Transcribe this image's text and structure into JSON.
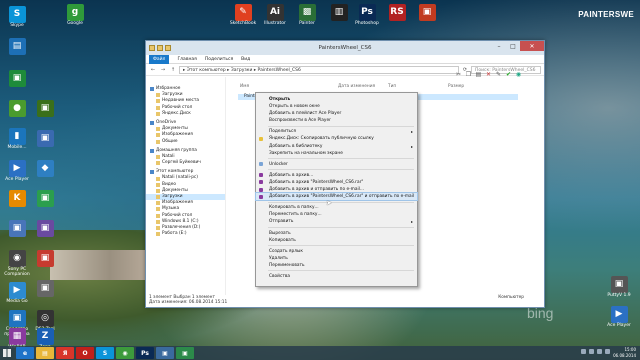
{
  "watermark": "PAINTERSWE",
  "bing": "bing",
  "desktop_icons_left": [
    {
      "label": "Skype",
      "icon": "skype-icon",
      "color": "#0a94d8",
      "glyph": "S"
    },
    {
      "label": "",
      "icon": "folder-icon",
      "color": "#1d6fb5",
      "glyph": "▤"
    },
    {
      "label": "",
      "icon": "app-icon",
      "color": "#1e8b3a",
      "glyph": "▣"
    },
    {
      "label": "",
      "icon": "green-app-icon",
      "color": "#4a9b2e",
      "glyph": "●"
    },
    {
      "label": "",
      "icon": "app-icon",
      "color": "#3a6f1a",
      "glyph": "▣"
    },
    {
      "label": "Mobile...",
      "icon": "mobile-icon",
      "color": "#1b75bc",
      "glyph": "▮"
    },
    {
      "label": "",
      "icon": "app-icon",
      "color": "#3a6ab0",
      "glyph": "▣"
    },
    {
      "label": "Ace Player",
      "icon": "ace-player-icon",
      "color": "#2b70c4",
      "glyph": "▶"
    },
    {
      "label": "",
      "icon": "app-icon",
      "color": "#2e7fc2",
      "glyph": "◆"
    },
    {
      "label": "",
      "icon": "k-icon",
      "color": "#e68a00",
      "glyph": "K"
    },
    {
      "label": "",
      "icon": "app-icon",
      "color": "#2b9e4d",
      "glyph": "▣"
    },
    {
      "label": "",
      "icon": "app-icon",
      "color": "#4875b9",
      "glyph": "▣"
    },
    {
      "label": "",
      "icon": "app-icon",
      "color": "#6a4aa0",
      "glyph": "▣"
    },
    {
      "label": "Sony PC Companion",
      "icon": "sony-icon",
      "color": "#444444",
      "glyph": "◉"
    },
    {
      "label": "",
      "icon": "app-icon",
      "color": "#c63b2f",
      "glyph": "▣"
    },
    {
      "label": "Media Go",
      "icon": "media-go-icon",
      "color": "#2d8bd0",
      "glyph": "▶"
    },
    {
      "label": "",
      "icon": "app-icon",
      "color": "#666666",
      "glyph": "▣"
    },
    {
      "label": "Средство просмотра",
      "icon": "viewer-icon",
      "color": "#1f74c0",
      "glyph": "▣"
    },
    {
      "label": "DS3 Tool",
      "icon": "ds3-icon",
      "color": "#333333",
      "glyph": "◎"
    },
    {
      "label": "WinRAR",
      "icon": "winrar-icon",
      "color": "#8a3a9e",
      "glyph": "▦"
    },
    {
      "label": "Zona",
      "icon": "zona-icon",
      "color": "#1a5fb4",
      "glyph": "Z"
    }
  ],
  "desktop_icons_top": [
    {
      "label": "Google",
      "icon": "google-icon",
      "color": "#2f9a3a",
      "glyph": "g"
    },
    {
      "label": "SketchBook",
      "icon": "sketchbook-icon",
      "color": "#e04020",
      "glyph": "✎"
    },
    {
      "label": "Illustrator",
      "icon": "illustrator-icon",
      "color": "#333333",
      "glyph": "Ai"
    },
    {
      "label": "Painter",
      "icon": "painter-icon",
      "color": "#2a6e36",
      "glyph": "▩"
    },
    {
      "label": "",
      "icon": "app-icon",
      "color": "#222222",
      "glyph": "▥"
    },
    {
      "label": "Photoshop",
      "icon": "photoshop-icon",
      "color": "#0a2a54",
      "glyph": "Ps"
    },
    {
      "label": "",
      "icon": "rs-icon",
      "color": "#b22222",
      "glyph": "RS"
    },
    {
      "label": "",
      "icon": "app-icon",
      "color": "#c13b20",
      "glyph": "▣"
    }
  ],
  "desktop_icons_right": [
    {
      "label": "PuttyV 1.9",
      "icon": "putty-icon",
      "color": "#555555",
      "glyph": "▣"
    },
    {
      "label": "Ace Player",
      "icon": "ace-player-icon",
      "color": "#2b70c4",
      "glyph": "▶"
    }
  ],
  "window": {
    "title": "PaintersWheel_CS6",
    "ribbon_tabs": [
      "Файл",
      "Главная",
      "Поделиться",
      "Вид"
    ],
    "path": "▸  Этот компьютер  ▸  Загрузки  ▸  PaintersWheel_CS6",
    "search_placeholder": "Поиск: PaintersWheel_CS6",
    "columns": [
      "Имя",
      "Дата изменения",
      "Тип",
      "Размер"
    ],
    "file_name": "PaintersWheel_CS6",
    "status_left": "1 элемент    Выбран 1 элемент",
    "status_left2": "Дата изменения: 06.08.2014 15:11",
    "status_right": "Компьютер"
  },
  "nav": [
    {
      "label": "Избранное",
      "level": 0
    },
    {
      "label": "Загрузки",
      "level": 1
    },
    {
      "label": "Недавние места",
      "level": 1
    },
    {
      "label": "Рабочий стол",
      "level": 1
    },
    {
      "label": "Яндекс.Диск",
      "level": 1
    },
    {
      "label": "OneDrive",
      "level": 0
    },
    {
      "label": "Документы",
      "level": 1
    },
    {
      "label": "Изображения",
      "level": 1
    },
    {
      "label": "Общие",
      "level": 1
    },
    {
      "label": "Домашняя группа",
      "level": 0
    },
    {
      "label": "Natali",
      "level": 1
    },
    {
      "label": "Сергей Буйкевич",
      "level": 1
    },
    {
      "label": "Этот компьютер",
      "level": 0
    },
    {
      "label": "Natali (natali-pc)",
      "level": 1
    },
    {
      "label": "Видео",
      "level": 1
    },
    {
      "label": "Документы",
      "level": 1
    },
    {
      "label": "Загрузки",
      "level": 1,
      "selected": true
    },
    {
      "label": "Изображения",
      "level": 1
    },
    {
      "label": "Музыка",
      "level": 1
    },
    {
      "label": "Рабочий стол",
      "level": 1
    },
    {
      "label": "Windows 8.1 (C:)",
      "level": 1
    },
    {
      "label": "Развлечения (D:)",
      "level": 1
    },
    {
      "label": "Работа (E:)",
      "level": 1
    }
  ],
  "context_menu": [
    {
      "label": "Открыть",
      "bold": true
    },
    {
      "label": "Открыть в новом окне"
    },
    {
      "label": "Добавить в плейлист Ace Player"
    },
    {
      "label": "Воспроизвести в Ace Player"
    },
    {
      "sep": true
    },
    {
      "label": "Поделиться",
      "arrow": true
    },
    {
      "label": "Яндекс.Диск: Скопировать публичную ссылку",
      "icon_color": "#e8c13a"
    },
    {
      "label": "Добавить в библиотеку",
      "arrow": true
    },
    {
      "label": "Закрепить на начальном экране"
    },
    {
      "sep": true
    },
    {
      "label": "Unlocker",
      "icon_color": "#7aa4d6"
    },
    {
      "sep": true
    },
    {
      "label": "Добавить в архив...",
      "icon_color": "#8a3a9e"
    },
    {
      "label": "Добавить в архив \"PaintersWheel_CS6.rar\"",
      "icon_color": "#8a3a9e"
    },
    {
      "label": "Добавить в архив и отправить по e-mail...",
      "icon_color": "#8a3a9e"
    },
    {
      "label": "Добавить в архив \"PaintersWheel_CS6.rar\" и отправить по e-mail",
      "icon_color": "#8a3a9e",
      "highlight": true
    },
    {
      "sep": true
    },
    {
      "label": "Копировать в папку..."
    },
    {
      "label": "Переместить в папку..."
    },
    {
      "label": "Отправить",
      "arrow": true
    },
    {
      "sep": true
    },
    {
      "label": "Вырезать"
    },
    {
      "label": "Копировать"
    },
    {
      "sep": true
    },
    {
      "label": "Создать ярлык"
    },
    {
      "label": "Удалить"
    },
    {
      "label": "Переименовать"
    },
    {
      "sep": true
    },
    {
      "label": "Свойства"
    }
  ],
  "taskbar": [
    {
      "icon": "ie-icon",
      "color": "#1e73c8",
      "glyph": "e"
    },
    {
      "icon": "explorer-icon",
      "color": "#e8b63a",
      "glyph": "▤"
    },
    {
      "icon": "yandex-icon",
      "color": "#d8352a",
      "glyph": "Я"
    },
    {
      "icon": "opera-icon",
      "color": "#c0201b",
      "glyph": "O"
    },
    {
      "icon": "skype-icon",
      "color": "#0a94d8",
      "glyph": "S"
    },
    {
      "icon": "chrome-icon",
      "color": "#3c9a3c",
      "glyph": "◉"
    },
    {
      "icon": "ps-icon",
      "color": "#0a2a54",
      "glyph": "Ps"
    },
    {
      "icon": "app-icon",
      "color": "#3a6a9e",
      "glyph": "▣"
    },
    {
      "icon": "app-icon",
      "color": "#2c8a4a",
      "glyph": "▣"
    }
  ],
  "clock": {
    "time": "15:00",
    "date": "06.08.2014"
  }
}
